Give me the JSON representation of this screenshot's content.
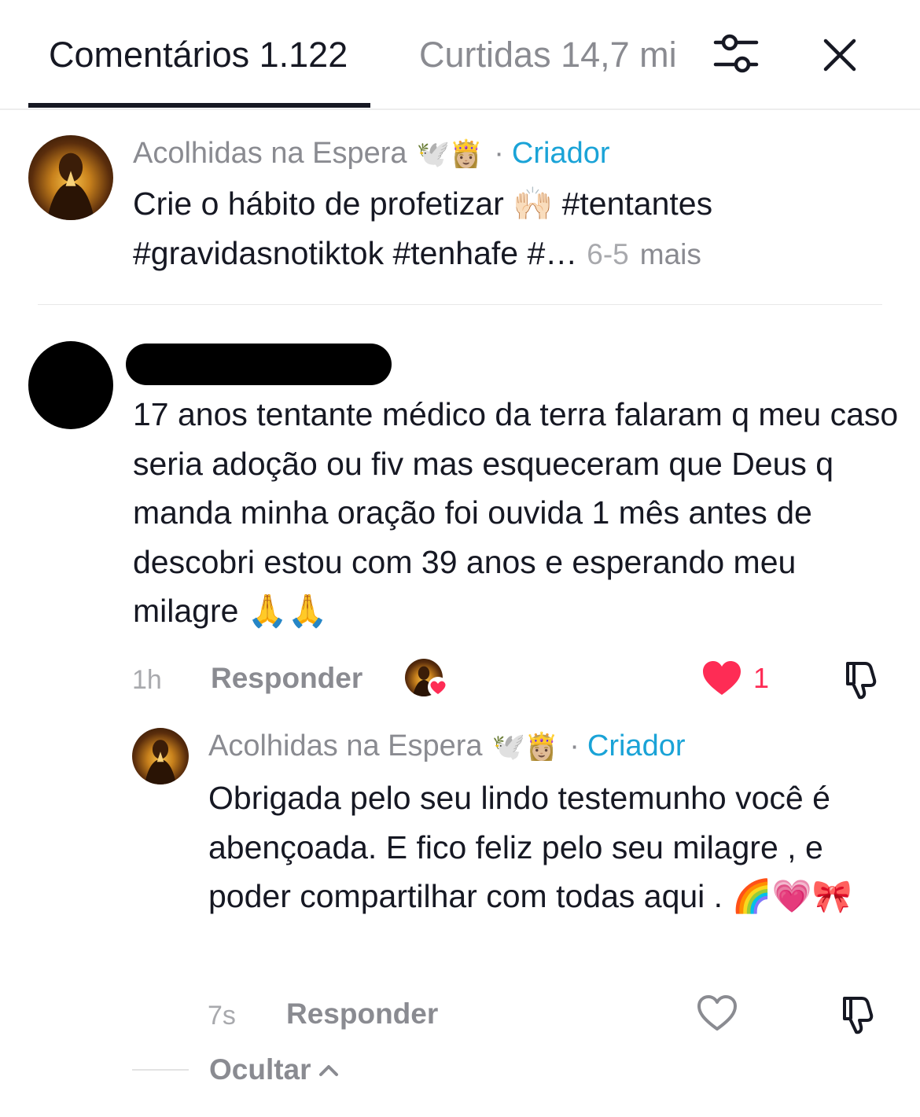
{
  "tabs": {
    "comments": "Comentários 1.122",
    "likes": "Curtidas 14,7 mi"
  },
  "icons": {
    "filter": "sliders-icon",
    "close": "close-icon",
    "like_filled": "heart-filled-icon",
    "like_outline": "heart-outline-icon",
    "dislike": "thumbs-down-icon"
  },
  "colors": {
    "creator_badge": "#1aa3d7",
    "like_red": "#fe2c55"
  },
  "caption": {
    "author": "Acolhidas na Espera",
    "author_emoji": "🕊️👸🏼",
    "separator": "·",
    "badge": "Criador",
    "text": "Crie o hábito de profetizar 🙌🏻 #tentantes #gravidasnotiktok #tenhafe #…",
    "date": "6-5",
    "more": "mais"
  },
  "comment": {
    "text": "17 anos tentante médico da terra falaram q meu caso seria adoção ou fiv mas esqueceram que Deus q manda minha oração foi ouvida 1 mês antes de descobri estou com 39 anos e esperando meu milagre 🙏🙏",
    "time": "1h",
    "reply_label": "Responder",
    "likes": "1"
  },
  "reply": {
    "author": "Acolhidas na Espera",
    "author_emoji": "🕊️👸🏼",
    "separator": "·",
    "badge": "Criador",
    "text": "Obrigada pelo seu lindo testemunho você é abençoada. E fico feliz pelo seu milagre , e poder compartilhar com todas aqui . 🌈💗🎀",
    "time": "7s",
    "reply_label": "Responder"
  },
  "hide_label": "Ocultar"
}
